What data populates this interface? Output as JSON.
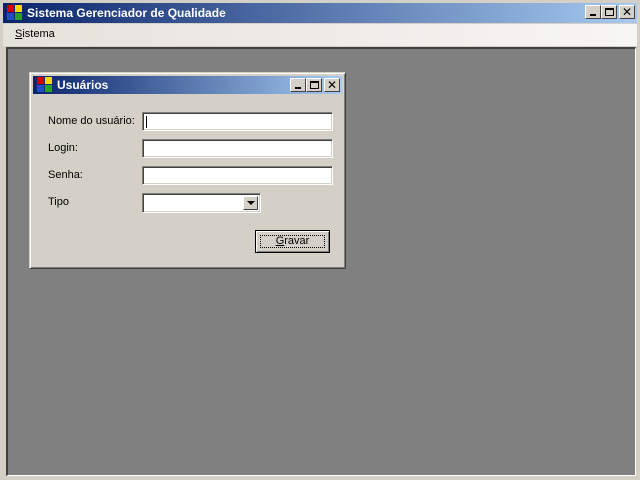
{
  "main_window": {
    "title": "Sistema Gerenciador de Qualidade",
    "menu": [
      {
        "label": "Sistema",
        "accel": "S",
        "rest": "istema"
      }
    ]
  },
  "child_window": {
    "title": "Usuários",
    "fields": {
      "nome_label": "Nome do usuário:",
      "nome_value": "",
      "login_label": "Login:",
      "login_value": "",
      "senha_label": "Senha:",
      "senha_value": "",
      "tipo_label": "Tipo",
      "tipo_selected": ""
    },
    "gravar": {
      "label": "Gravar",
      "accel": "G",
      "rest": "ravar"
    }
  },
  "colors": {
    "titlebar_start": "#0a246a",
    "titlebar_end": "#a6caf0",
    "mdi_background": "#808080",
    "window_face": "#d4d0c8"
  },
  "icons": [
    "app-icon",
    "minimize-icon",
    "maximize-icon",
    "close-icon",
    "dropdown-arrow-icon"
  ]
}
